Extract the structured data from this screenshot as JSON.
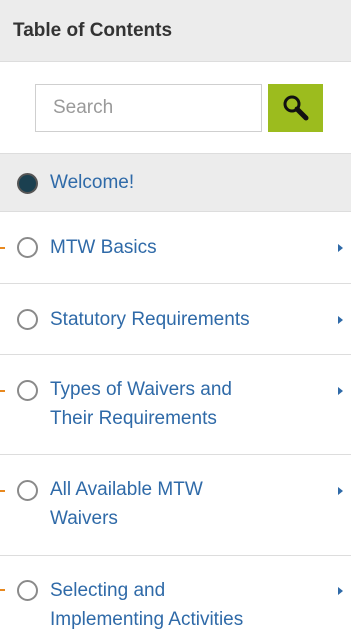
{
  "header": {
    "title": "Table of Contents"
  },
  "search": {
    "placeholder": "Search",
    "value": "",
    "button_icon": "search-icon"
  },
  "colors": {
    "accent_green": "#9cbc1e",
    "link_blue": "#2f6aa8",
    "marker_orange": "#e8891f",
    "active_bg": "#ececec"
  },
  "toc": {
    "items": [
      {
        "label": "Welcome!",
        "active": true,
        "has_children": false,
        "marker": false
      },
      {
        "label": "MTW Basics",
        "active": false,
        "has_children": true,
        "marker": true
      },
      {
        "label": "Statutory Requirements",
        "active": false,
        "has_children": true,
        "marker": false
      },
      {
        "label": "Types of Waivers and\nTheir Requirements",
        "active": false,
        "has_children": true,
        "marker": true
      },
      {
        "label": "All Available MTW\nWaivers",
        "active": false,
        "has_children": true,
        "marker": true
      },
      {
        "label": "Selecting and\nImplementing Activities",
        "active": false,
        "has_children": true,
        "marker": true
      }
    ]
  }
}
